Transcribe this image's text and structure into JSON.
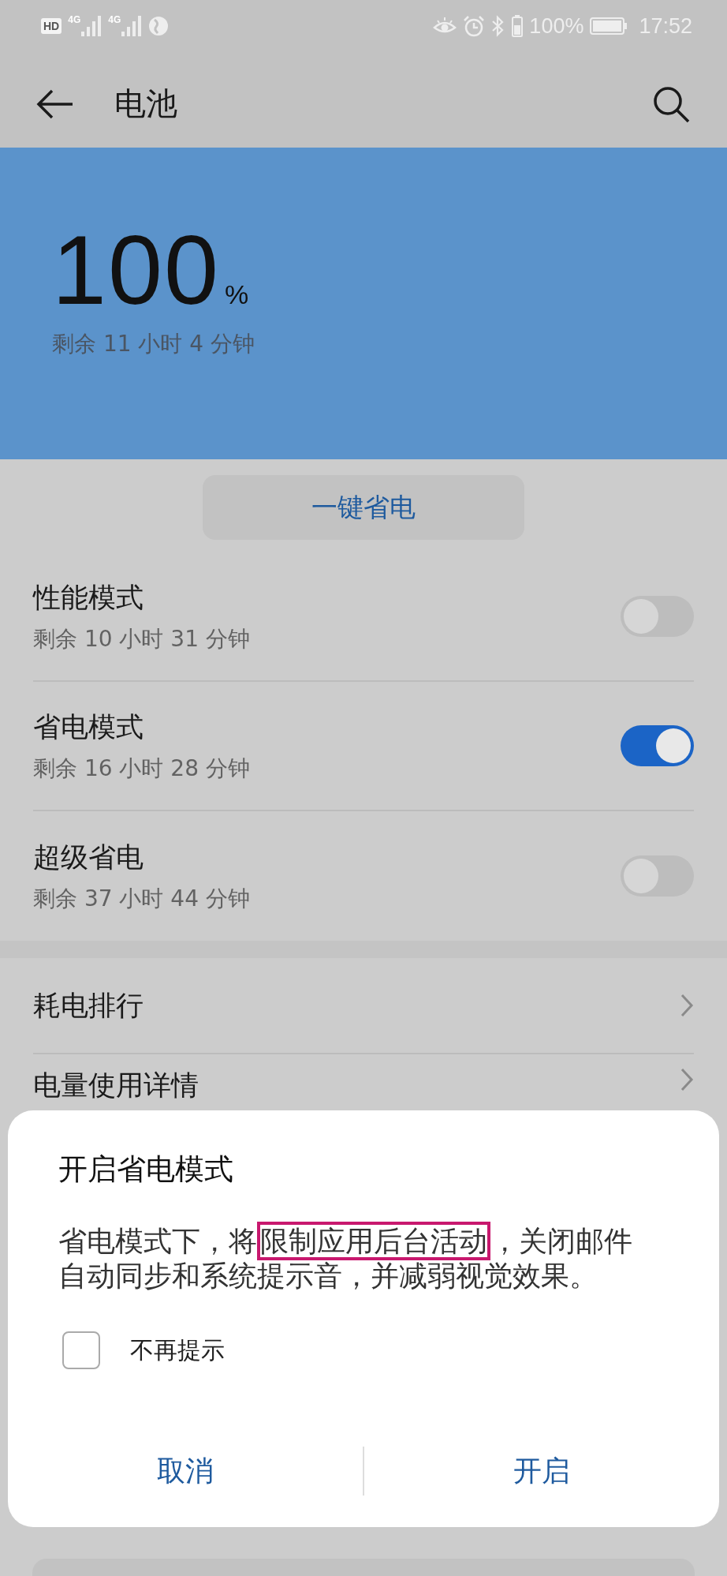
{
  "status_bar": {
    "hd_label": "HD",
    "network_labels": [
      "4G",
      "4G"
    ],
    "battery_percent": "100%",
    "time": "17:52"
  },
  "toolbar": {
    "title": "电池"
  },
  "battery": {
    "percent": "100",
    "unit": "%",
    "remaining": "剩余 11 小时 4 分钟"
  },
  "save_button": "一键省电",
  "modes": [
    {
      "title": "性能模式",
      "subtitle": "剩余 10 小时 31 分钟",
      "on": false
    },
    {
      "title": "省电模式",
      "subtitle": "剩余 16 小时 28 分钟",
      "on": true
    },
    {
      "title": "超级省电",
      "subtitle": "剩余 37 小时 44 分钟",
      "on": false
    }
  ],
  "links": [
    {
      "label": "耗电排行"
    },
    {
      "label": "电量使用详情"
    }
  ],
  "dialog": {
    "title": "开启省电模式",
    "message": [
      {
        "text": "省电模式下，将",
        "highlighted": false
      },
      {
        "text": "限制应用后台活动",
        "highlighted": true
      },
      {
        "text": "，关闭邮件自动同步和系统提示音，并减弱视觉效果。",
        "highlighted": false
      }
    ],
    "checkbox": {
      "label": "不再提示",
      "checked": false
    },
    "buttons": [
      "取消",
      "开启"
    ]
  }
}
